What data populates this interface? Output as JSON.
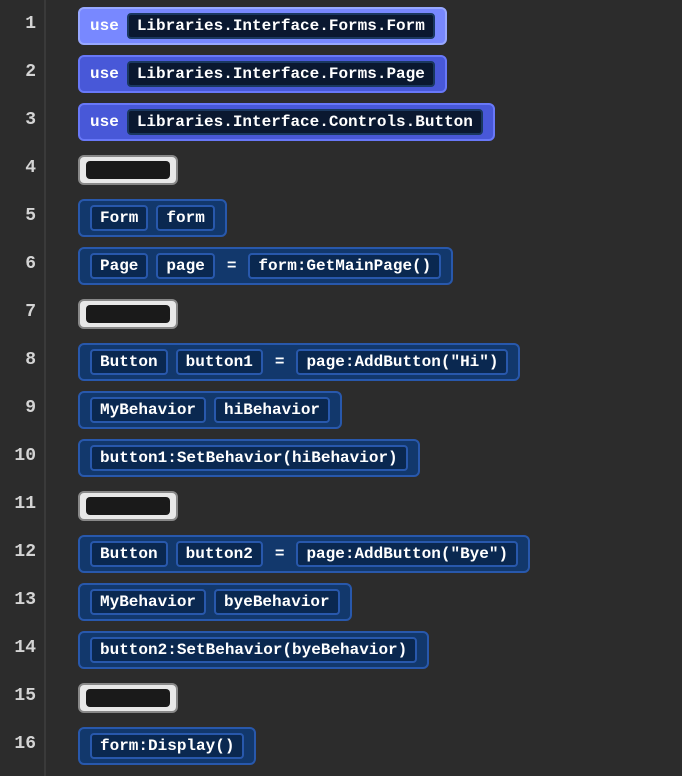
{
  "lines": [
    {
      "num": "1",
      "type": "use",
      "keyword": "use",
      "lib": "Libraries.Interface.Forms.Form",
      "variant": "light"
    },
    {
      "num": "2",
      "type": "use",
      "keyword": "use",
      "lib": "Libraries.Interface.Forms.Page",
      "variant": "normal"
    },
    {
      "num": "3",
      "type": "use",
      "keyword": "use",
      "lib": "Libraries.Interface.Controls.Button",
      "variant": "normal"
    },
    {
      "num": "4",
      "type": "empty"
    },
    {
      "num": "5",
      "type": "decl2",
      "t1": "Form",
      "t2": "form"
    },
    {
      "num": "6",
      "type": "assign",
      "t1": "Page",
      "t2": "page",
      "op": "=",
      "t3": "form:GetMainPage()"
    },
    {
      "num": "7",
      "type": "empty"
    },
    {
      "num": "8",
      "type": "assign",
      "t1": "Button",
      "t2": "button1",
      "op": "=",
      "t3": "page:AddButton(\"Hi\")"
    },
    {
      "num": "9",
      "type": "decl2",
      "t1": "MyBehavior",
      "t2": "hiBehavior"
    },
    {
      "num": "10",
      "type": "call",
      "t1": "button1:SetBehavior(hiBehavior)"
    },
    {
      "num": "11",
      "type": "empty"
    },
    {
      "num": "12",
      "type": "assign",
      "t1": "Button",
      "t2": "button2",
      "op": "=",
      "t3": "page:AddButton(\"Bye\")"
    },
    {
      "num": "13",
      "type": "decl2",
      "t1": "MyBehavior",
      "t2": "byeBehavior"
    },
    {
      "num": "14",
      "type": "call",
      "t1": "button2:SetBehavior(byeBehavior)"
    },
    {
      "num": "15",
      "type": "empty"
    },
    {
      "num": "16",
      "type": "call",
      "t1": "form:Display()"
    }
  ]
}
